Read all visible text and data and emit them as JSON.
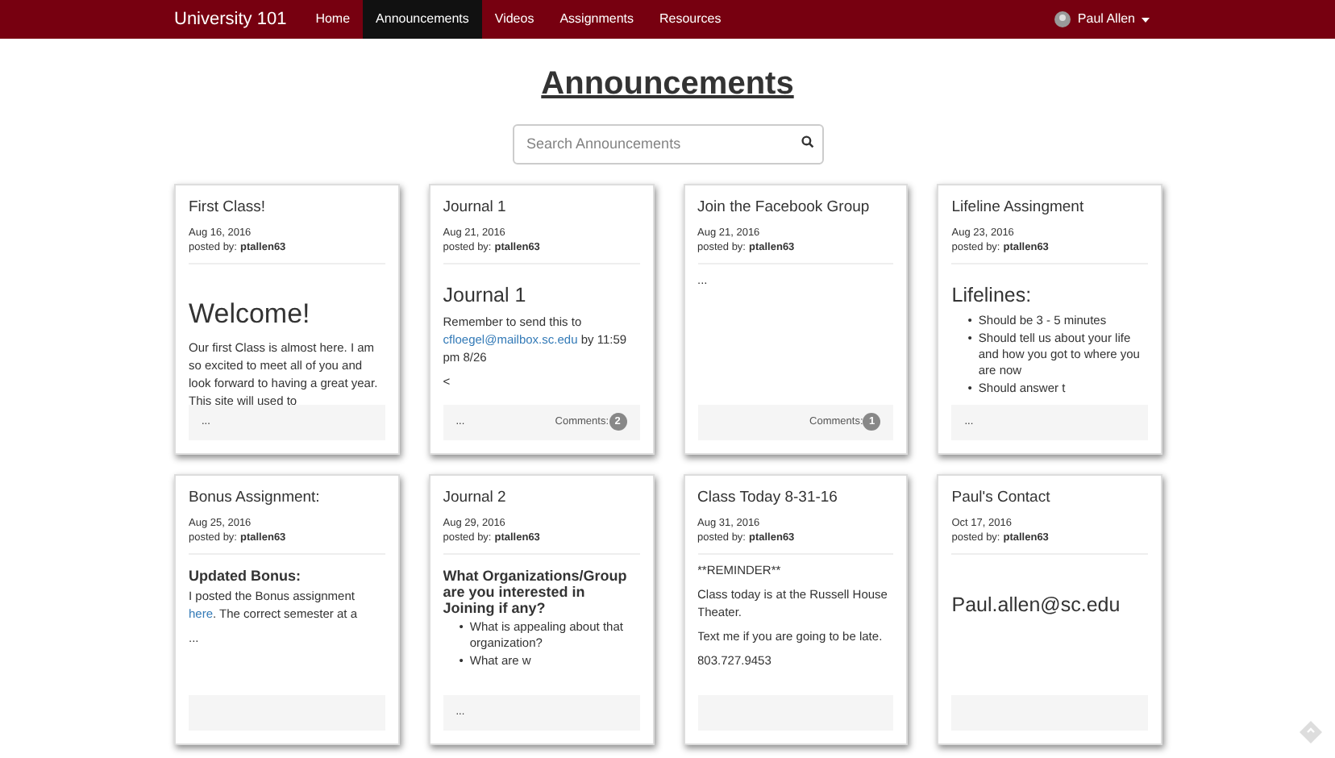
{
  "navbar": {
    "brand": "University 101",
    "links": [
      {
        "label": "Home",
        "selected": false
      },
      {
        "label": "Announcements",
        "selected": true
      },
      {
        "label": "Videos",
        "selected": false
      },
      {
        "label": "Assignments",
        "selected": false
      },
      {
        "label": "Resources",
        "selected": false
      }
    ],
    "user": "Paul Allen"
  },
  "title": "Announcements",
  "search": {
    "placeholder": "Search Announcements"
  },
  "cards": [
    {
      "title": "First Class!",
      "date": "Aug 16, 2016",
      "posted_label": "posted by:",
      "author": "ptallen63",
      "body": [
        {
          "kind": "heading",
          "text": "Welcome!"
        },
        {
          "kind": "paragraph",
          "parts": [
            {
              "kind": "text",
              "text": "Our first Class is almost here. I am so excited to meet all of you and look forward to having a great year. This site will used to"
            }
          ]
        }
      ],
      "footer": {
        "ellipsis": "..."
      }
    },
    {
      "title": "Journal 1",
      "date": "Aug 21, 2016",
      "posted_label": "posted by:",
      "author": "ptallen63",
      "body": [
        {
          "kind": "heading2",
          "text": "Journal 1"
        },
        {
          "kind": "paragraph",
          "parts": [
            {
              "kind": "text",
              "text": "Remember to send this to "
            },
            {
              "kind": "link",
              "text": "cfloegel@mailbox.sc.edu"
            },
            {
              "kind": "text",
              "text": " by 11:59 pm 8/26"
            }
          ]
        },
        {
          "kind": "paragraph",
          "parts": [
            {
              "kind": "text",
              "text": "<"
            }
          ]
        }
      ],
      "footer": {
        "ellipsis": "...",
        "comments_label": "Comments:",
        "comments_count": "2"
      }
    },
    {
      "title": "Join the Facebook Group",
      "date": "Aug 21, 2016",
      "posted_label": "posted by:",
      "author": "ptallen63",
      "body": [
        {
          "kind": "paragraph",
          "parts": [
            {
              "kind": "text",
              "text": "..."
            }
          ]
        }
      ],
      "footer": {
        "comments_label": "Comments:",
        "comments_count": "1"
      }
    },
    {
      "title": "Lifeline Assingment",
      "date": "Aug 23, 2016",
      "posted_label": "posted by:",
      "author": "ptallen63",
      "body": [
        {
          "kind": "heading2",
          "text": "Lifelines:"
        },
        {
          "kind": "list",
          "items": [
            {
              "bullet": "•",
              "text": "Should be 3 - 5 minutes"
            },
            {
              "bullet": "•",
              "text": "Should tell us about your life and how you got to where you are now"
            },
            {
              "bullet": "•",
              "text": "Should answer t"
            }
          ]
        }
      ],
      "footer": {
        "ellipsis": "..."
      }
    },
    {
      "title": "Bonus Assignment:",
      "date": "Aug 25, 2016",
      "posted_label": "posted by:",
      "author": "ptallen63",
      "body": [
        {
          "kind": "heading3",
          "text": "Updated Bonus:"
        },
        {
          "kind": "paragraph",
          "parts": [
            {
              "kind": "text",
              "text": "I posted the Bonus assignment "
            },
            {
              "kind": "link",
              "text": "here"
            },
            {
              "kind": "text",
              "text": ". The correct semester at a"
            }
          ]
        },
        {
          "kind": "paragraph",
          "parts": [
            {
              "kind": "text",
              "text": "..."
            }
          ]
        }
      ]
    },
    {
      "title": "Journal 2",
      "date": "Aug 29, 2016",
      "posted_label": "posted by:",
      "author": "ptallen63",
      "body": [
        {
          "kind": "heading3",
          "text": "What Organizations/Group are you interested in Joining if any?"
        },
        {
          "kind": "list",
          "items": [
            {
              "bullet": "•",
              "text": "What is appealing about that organization?"
            },
            {
              "bullet": "•",
              "text": "What are w"
            }
          ]
        }
      ],
      "footer": {
        "ellipsis": "..."
      }
    },
    {
      "title": "Class Today 8-31-16",
      "date": "Aug 31, 2016",
      "posted_label": "posted by:",
      "author": "ptallen63",
      "body": [
        {
          "kind": "paragraph",
          "parts": [
            {
              "kind": "text",
              "text": "**REMINDER**"
            }
          ]
        },
        {
          "kind": "paragraph",
          "parts": [
            {
              "kind": "text",
              "text": "Class today is at the Russell House Theater."
            }
          ]
        },
        {
          "kind": "paragraph",
          "parts": [
            {
              "kind": "text",
              "text": "Text me if you are going to be late."
            }
          ]
        },
        {
          "kind": "paragraph",
          "parts": [
            {
              "kind": "text",
              "text": "803.727.9453"
            }
          ]
        }
      ]
    },
    {
      "title": "Paul's Contact",
      "date": "Oct 17, 2016",
      "posted_label": "posted by:",
      "author": "ptallen63",
      "body": [
        {
          "kind": "spacer"
        },
        {
          "kind": "heading3big",
          "text": "Paul.allen@sc.edu"
        }
      ]
    }
  ]
}
